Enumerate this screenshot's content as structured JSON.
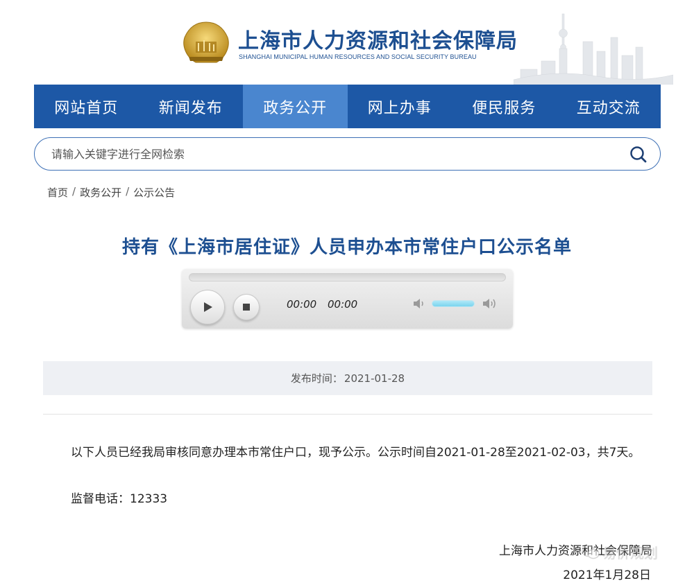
{
  "header": {
    "title": "上海市人力资源和社会保障局",
    "subtitle": "SHANGHAI MUNICIPAL HUMAN RESOURCES AND SOCIAL SECURITY BUREAU"
  },
  "nav": {
    "items": [
      "网站首页",
      "新闻发布",
      "政务公开",
      "网上办事",
      "便民服务",
      "互动交流"
    ],
    "active": "政务公开"
  },
  "search": {
    "placeholder": "请输入关键字进行全网检索"
  },
  "breadcrumb": [
    "首页",
    "政务公开",
    "公示公告"
  ],
  "article": {
    "title": "持有《上海市居住证》人员申办本市常住户口公示名单",
    "publish_label": "发布时间：",
    "publish_date": "2021-01-28",
    "paragraph": "以下人员已经我局审核同意办理本市常住户口，现予公示。公示时间自2021-01-28至2021-02-03，共7天。",
    "phone_line": "监督电话：12333",
    "sign_org": "上海市人力资源和社会保障局",
    "sign_date": "2021年1月28日"
  },
  "player": {
    "current_time": "00:00",
    "duration": "00:00",
    "progress": 0,
    "volume": 0.8
  },
  "watermark": "易侨规划",
  "colors": {
    "brand_blue": "#1d58a6",
    "nav_active": "#4a86cf",
    "title_blue": "#1d4f91"
  }
}
